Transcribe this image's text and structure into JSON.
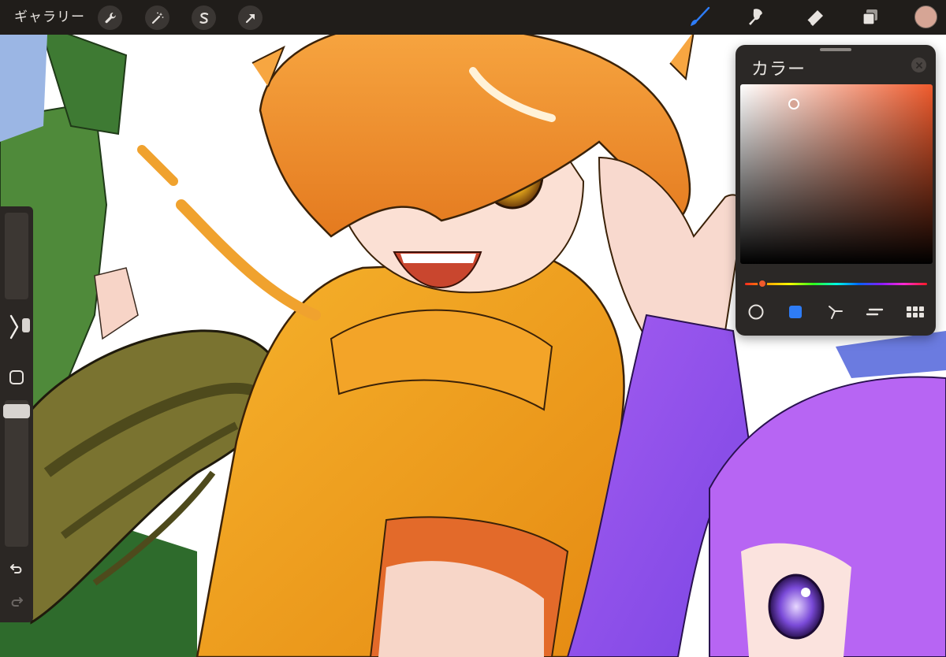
{
  "toolbar": {
    "gallery_label": "ギャラリー",
    "left_tools": [
      "wrench-icon",
      "magic-wand-icon",
      "selection-s-icon",
      "transform-arrow-icon"
    ],
    "right_tools": [
      "brush-icon",
      "smudge-icon",
      "eraser-icon",
      "layers-icon"
    ],
    "active_tool": "brush-icon",
    "current_color": "#d6a595",
    "active_tool_color": "#2e7cf6"
  },
  "sidebar": {
    "brush_size_level": 0.25,
    "opacity_level": 0.97,
    "buttons": [
      "modify-button",
      "square-button",
      "undo-button",
      "redo-button"
    ]
  },
  "color_panel": {
    "title": "カラー",
    "hue_fraction": 0.01,
    "saturation": 0.28,
    "brightness": 0.88,
    "modes": [
      "disc-mode",
      "classic-mode",
      "harmony-mode",
      "value-mode",
      "palettes-mode"
    ],
    "active_mode": "classic-mode",
    "hue_color": "#ef5a2c"
  }
}
